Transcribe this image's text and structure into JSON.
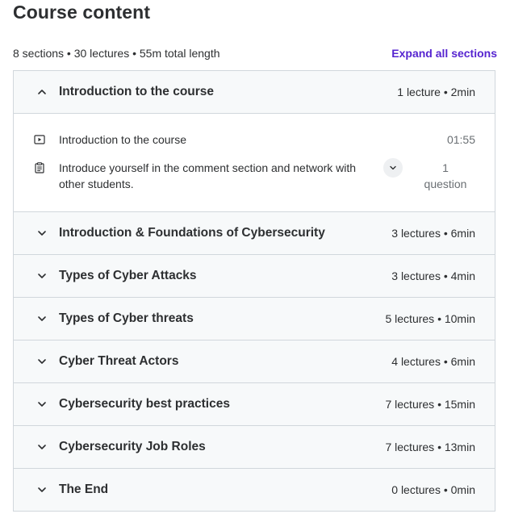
{
  "page": {
    "title": "Course content",
    "summary": "8 sections • 30 lectures • 55m total length",
    "expand_all_label": "Expand all sections"
  },
  "sections": [
    {
      "title": "Introduction to the course",
      "meta": "1 lecture • 2min",
      "expanded": true,
      "lectures": [
        {
          "icon": "video-icon",
          "title": "Introduction to the course",
          "duration": "01:55"
        },
        {
          "icon": "assignment-icon",
          "title": "Introduce yourself in the comment section and network with other students.",
          "question_count": "1",
          "question_label": "question"
        }
      ]
    },
    {
      "title": "Introduction & Foundations of Cybersecurity",
      "meta": "3 lectures • 6min",
      "expanded": false
    },
    {
      "title": "Types of Cyber Attacks",
      "meta": "3 lectures • 4min",
      "expanded": false
    },
    {
      "title": "Types of Cyber threats",
      "meta": "5 lectures • 10min",
      "expanded": false
    },
    {
      "title": "Cyber Threat Actors",
      "meta": "4 lectures • 6min",
      "expanded": false
    },
    {
      "title": "Cybersecurity best practices",
      "meta": "7 lectures • 15min",
      "expanded": false
    },
    {
      "title": "Cybersecurity Job Roles",
      "meta": "7 lectures • 13min",
      "expanded": false
    },
    {
      "title": "The End",
      "meta": "0 lectures • 0min",
      "expanded": false
    }
  ],
  "colors": {
    "accent": "#5624d0",
    "header_bg": "#f7f9fa",
    "border": "#d1d7dc",
    "text": "#2d2f31",
    "muted": "#6a6f73"
  }
}
